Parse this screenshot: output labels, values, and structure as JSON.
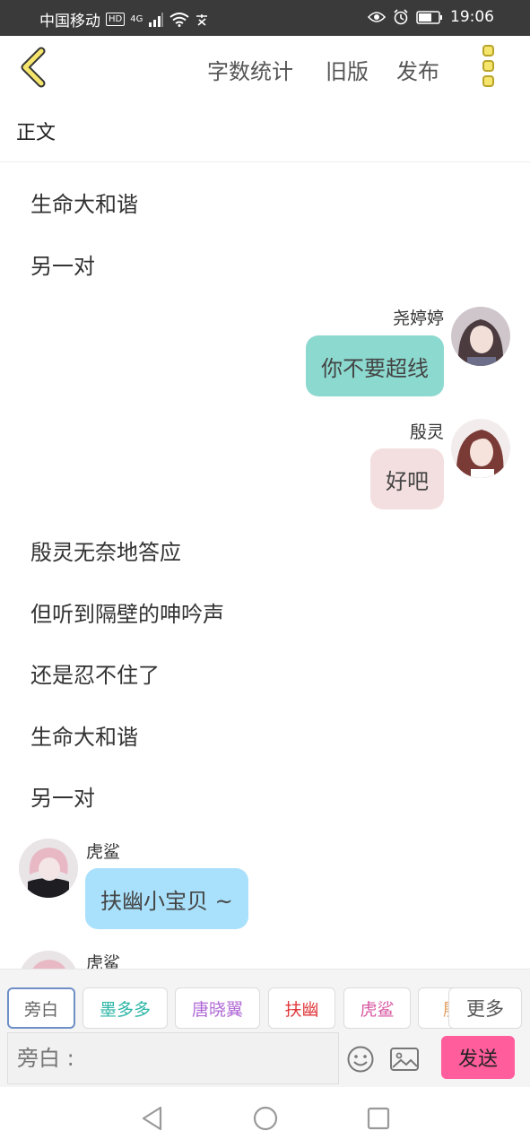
{
  "status_bar": {
    "carrier": "中国移动",
    "hd": "HD",
    "signal": "4G",
    "time": "19:06"
  },
  "header": {
    "word_count": "字数统计",
    "old_version": "旧版",
    "publish": "发布"
  },
  "section_label": "正文",
  "content": {
    "n1": "生命大和谐",
    "n2": "另一对",
    "m1": {
      "name": "尧婷婷",
      "text": "你不要超线",
      "bubble_color": "#8cd9cf"
    },
    "m2": {
      "name": "殷灵",
      "text": "好吧",
      "bubble_color": "#f4dfe0"
    },
    "n3": "殷灵无奈地答应",
    "n4": "但听到隔壁的呻吟声",
    "n5": "还是忍不住了",
    "n6": "生命大和谐",
    "n7": "另一对",
    "m3": {
      "name": "虎鲨",
      "text": "扶幽小宝贝 ~",
      "bubble_color": "#a9e0fb"
    },
    "m4": {
      "name": "虎鲨"
    }
  },
  "roles": [
    {
      "label": "旁白",
      "color": "#666666"
    },
    {
      "label": "墨多多",
      "color": "#2bb5a6"
    },
    {
      "label": "唐晓翼",
      "color": "#b06ad6"
    },
    {
      "label": "扶幽",
      "color": "#e0383b"
    },
    {
      "label": "虎鲨",
      "color": "#d85aa3"
    },
    {
      "label": "殷",
      "color": "#e3a166"
    }
  ],
  "more_label": "更多",
  "input": {
    "placeholder": "旁白 :"
  },
  "send_label": "发送"
}
